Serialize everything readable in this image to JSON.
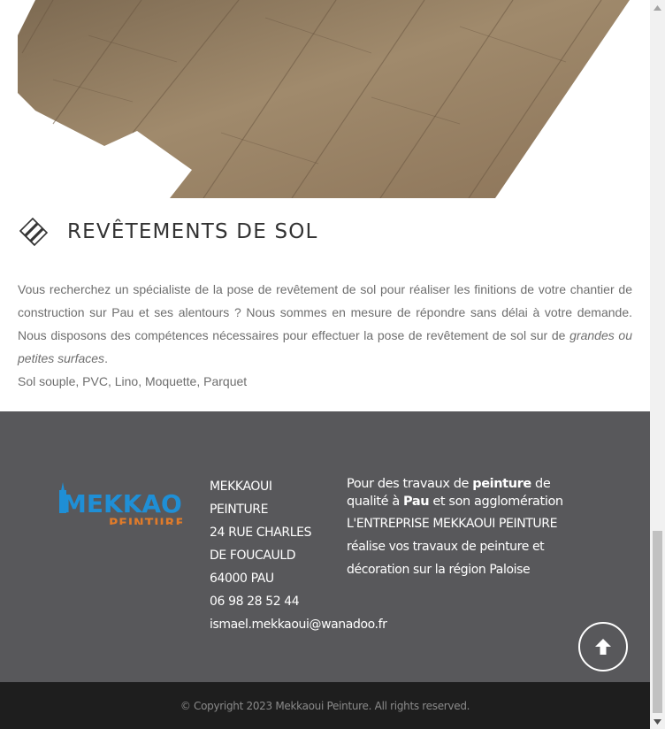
{
  "section": {
    "title": "REVÊTEMENTS DE SOL",
    "paragraph_main": "Vous recherchez un spécialiste de la pose de revêtement de sol pour réaliser les finitions de votre chantier de construction sur Pau et ses alentours ? Nous sommes en mesure de répondre sans délai à votre demande. Nous disposons des compétences nécessaires pour effectuer la pose de revêtement de sol sur de ",
    "paragraph_emphasis": "grandes ou petites surfaces",
    "paragraph_end": ".",
    "materials": "Sol souple, PVC, Lino, Moquette, Parquet"
  },
  "footer": {
    "logo": {
      "word1": "MEKKAOUI",
      "word2": "PEINTURE",
      "colors": {
        "primary": "#1f8fd6",
        "secondary": "#e07b2a"
      }
    },
    "contact": {
      "company_line1": "MEKKAOUI",
      "company_line2": "PEINTURE",
      "address_line1": "24 RUE CHARLES",
      "address_line2": "DE FOUCAULD",
      "city": "64000 PAU",
      "phone": "06 98 28 52 44",
      "email": "ismael.mekkaoui@wanadoo.fr"
    },
    "about": {
      "lead_part1": "Pour des travaux de ",
      "lead_bold1": "peinture",
      "lead_part2": " de qualité à ",
      "lead_bold2": "Pau",
      "lead_part3": " et son agglomération",
      "line1": "L'ENTREPRISE MEKKAOUI PEINTURE",
      "line2": "réalise vos travaux de peinture et",
      "line3": "décoration sur la région Paloise"
    },
    "scroll_top_icon": "arrow-up-icon",
    "copyright": "© Copyright 2023 Mekkaoui Peinture. All rights reserved."
  },
  "colors": {
    "footer_bg": "#58585b",
    "bottom_bar_bg": "#1e1e1e",
    "heading": "#333333",
    "body_text": "#6e6e6e"
  }
}
